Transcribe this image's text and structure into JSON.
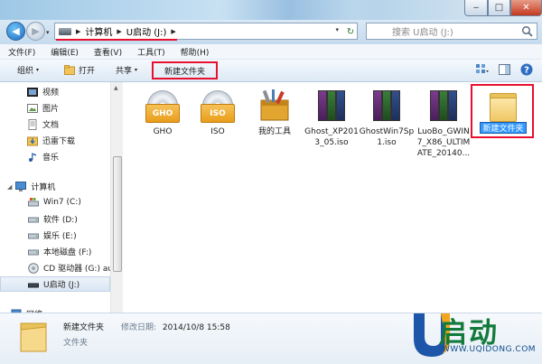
{
  "window": {
    "minimize_glyph": "‒",
    "maximize_glyph": "□",
    "close_glyph": "✕"
  },
  "address": {
    "crumbs": [
      "计算机",
      "U启动 (J:)"
    ],
    "dropdown_glyph": "▾",
    "refresh_glyph": "↻"
  },
  "search": {
    "placeholder": "搜索 U启动 (J:)"
  },
  "menu": {
    "items": [
      "文件(F)",
      "编辑(E)",
      "查看(V)",
      "工具(T)",
      "帮助(H)"
    ]
  },
  "toolbar": {
    "organize_label": "组织",
    "open_label": "打开",
    "share_label": "共享",
    "new_folder_label": "新建文件夹",
    "caret_glyph": "▾"
  },
  "sidebar": {
    "favorites": [
      "视频",
      "图片",
      "文档",
      "迅雷下载",
      "音乐"
    ],
    "computer_label": "计算机",
    "drives": [
      "Win7 (C:)",
      "软件 (D:)",
      "娱乐 (E:)",
      "本地磁盘 (F:)",
      "CD 驱动器 (G:) aut",
      "U启动 (J:)"
    ],
    "network_label": "网络"
  },
  "files": [
    {
      "name": "GHO",
      "kind": "disc",
      "badge": "GHO"
    },
    {
      "name": "ISO",
      "kind": "disc",
      "badge": "ISO"
    },
    {
      "name": "我的工具",
      "kind": "tools"
    },
    {
      "name": "Ghost_XP2013_05.iso",
      "kind": "rar"
    },
    {
      "name": "GhostWin7Sp1.iso",
      "kind": "rar"
    },
    {
      "name": "LuoBo_GWIN7_X86_ULTIMATE_20140...",
      "kind": "rar"
    },
    {
      "name": "新建文件夹",
      "kind": "folder",
      "renaming": true
    }
  ],
  "details": {
    "name": "新建文件夹",
    "modified_label": "修改日期:",
    "modified_value": "2014/10/8 15:58",
    "type": "文件夹"
  },
  "logo": {
    "text": "启动",
    "url": "WWW.UQIDONG.COM"
  },
  "colors": {
    "highlight_red": "#e8102e",
    "selection_blue": "#3399ff",
    "logo_green": "#127a3a",
    "logo_blue": "#0d4a8a"
  }
}
